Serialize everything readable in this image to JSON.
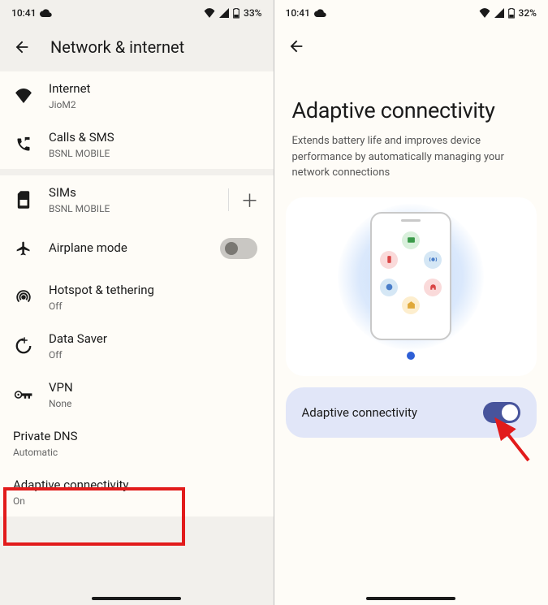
{
  "left": {
    "status": {
      "time": "10:41",
      "battery": "33%"
    },
    "header": {
      "title": "Network & internet"
    },
    "items": {
      "internet": {
        "title": "Internet",
        "sub": "JioM2"
      },
      "calls": {
        "title": "Calls & SMS",
        "sub": "BSNL MOBILE"
      },
      "sims": {
        "title": "SIMs",
        "sub": "BSNL MOBILE"
      },
      "airplane": {
        "title": "Airplane mode"
      },
      "hotspot": {
        "title": "Hotspot & tethering",
        "sub": "Off"
      },
      "datasaver": {
        "title": "Data Saver",
        "sub": "Off"
      },
      "vpn": {
        "title": "VPN",
        "sub": "None"
      },
      "dns": {
        "title": "Private DNS",
        "sub": "Automatic"
      },
      "adaptive": {
        "title": "Adaptive connectivity",
        "sub": "On"
      }
    }
  },
  "right": {
    "status": {
      "time": "10:41",
      "battery": "32%"
    },
    "title": "Adaptive connectivity",
    "desc": "Extends battery life and improves device performance by automatically managing your network connections",
    "toggle_label": "Adaptive connectivity",
    "toggle_state": "on"
  }
}
